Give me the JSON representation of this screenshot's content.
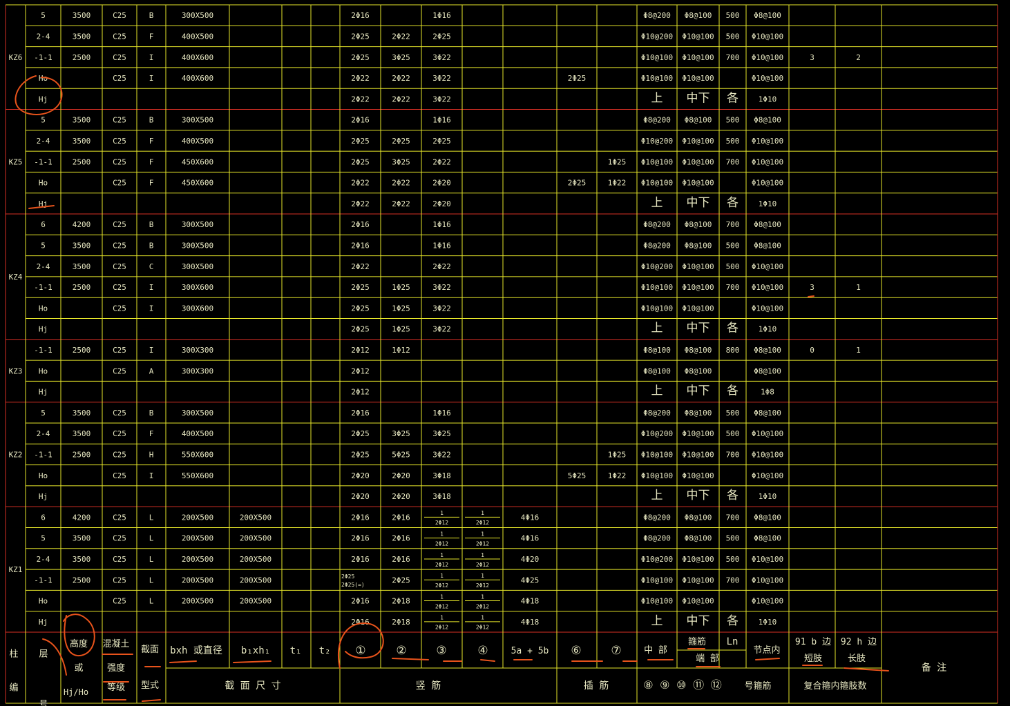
{
  "colors": {
    "background": "#000000",
    "grid": "#e6e62a",
    "group_divider": "#d93025",
    "text": "#e6e6c0",
    "annotation": "#e8531b"
  },
  "columns": [
    "group",
    "floor",
    "height",
    "grade",
    "type",
    "bxh",
    "bh1",
    "t1",
    "t2",
    "r1",
    "r2",
    "r3",
    "r4",
    "r5",
    "r6",
    "r7",
    "s_mid",
    "s_end",
    "ln",
    "s_node",
    "q1",
    "q2",
    "remark"
  ],
  "groups": [
    {
      "name": "KZ6",
      "rows": [
        {
          "floor": "5",
          "height": "3500",
          "grade": "C25",
          "type": "B",
          "bxh": "300X500",
          "r1": "2Φ16",
          "r3": "1Φ16",
          "s_mid": "Φ8@200",
          "s_end": "Φ8@100",
          "ln": "500",
          "s_node": "Φ8@100"
        },
        {
          "floor": "2-4",
          "height": "3500",
          "grade": "C25",
          "type": "F",
          "bxh": "400X500",
          "r1": "2Φ25",
          "r2": "2Φ22",
          "r3": "2Φ25",
          "s_mid": "Φ10@200",
          "s_end": "Φ10@100",
          "ln": "500",
          "s_node": "Φ10@100"
        },
        {
          "floor": "-1-1",
          "height": "2500",
          "grade": "C25",
          "type": "I",
          "bxh": "400X600",
          "r1": "2Φ25",
          "r2": "3Φ25",
          "r3": "3Φ22",
          "s_mid": "Φ10@100",
          "s_end": "Φ10@100",
          "ln": "700",
          "s_node": "Φ10@100",
          "q1": "3",
          "q2": "2"
        },
        {
          "floor": "Ho",
          "grade": "C25",
          "type": "I",
          "bxh": "400X600",
          "r1": "2Φ22",
          "r2": "2Φ22",
          "r3": "3Φ22",
          "r6": "2Φ25",
          "s_mid": "Φ10@100",
          "s_end": "Φ10@100",
          "s_node": "Φ10@100"
        },
        {
          "floor": "Hj",
          "r1": "2Φ22",
          "r2": "2Φ22",
          "r3": "3Φ22",
          "s_mid": "上",
          "s_end": "中下",
          "ln": "各",
          "s_node": "1Φ10"
        }
      ]
    },
    {
      "name": "KZ5",
      "rows": [
        {
          "floor": "5",
          "height": "3500",
          "grade": "C25",
          "type": "B",
          "bxh": "300X500",
          "r1": "2Φ16",
          "r3": "1Φ16",
          "s_mid": "Φ8@200",
          "s_end": "Φ8@100",
          "ln": "500",
          "s_node": "Φ8@100"
        },
        {
          "floor": "2-4",
          "height": "3500",
          "grade": "C25",
          "type": "F",
          "bxh": "400X500",
          "r1": "2Φ25",
          "r2": "2Φ25",
          "r3": "2Φ25",
          "s_mid": "Φ10@200",
          "s_end": "Φ10@100",
          "ln": "500",
          "s_node": "Φ10@100"
        },
        {
          "floor": "-1-1",
          "height": "2500",
          "grade": "C25",
          "type": "F",
          "bxh": "450X600",
          "r1": "2Φ25",
          "r2": "3Φ25",
          "r3": "2Φ22",
          "r7": "1Φ25",
          "s_mid": "Φ10@100",
          "s_end": "Φ10@100",
          "ln": "700",
          "s_node": "Φ10@100"
        },
        {
          "floor": "Ho",
          "grade": "C25",
          "type": "F",
          "bxh": "450X600",
          "r1": "2Φ22",
          "r2": "2Φ22",
          "r3": "2Φ20",
          "r6": "2Φ25",
          "r7": "1Φ22",
          "s_mid": "Φ10@100",
          "s_end": "Φ10@100",
          "s_node": "Φ10@100"
        },
        {
          "floor": "Hj",
          "r1": "2Φ22",
          "r2": "2Φ22",
          "r3": "2Φ20",
          "s_mid": "上",
          "s_end": "中下",
          "ln": "各",
          "s_node": "1Φ10"
        }
      ]
    },
    {
      "name": "KZ4",
      "rows": [
        {
          "floor": "6",
          "height": "4200",
          "grade": "C25",
          "type": "B",
          "bxh": "300X500",
          "r1": "2Φ16",
          "r3": "1Φ16",
          "s_mid": "Φ8@200",
          "s_end": "Φ8@100",
          "ln": "700",
          "s_node": "Φ8@100"
        },
        {
          "floor": "5",
          "height": "3500",
          "grade": "C25",
          "type": "B",
          "bxh": "300X500",
          "r1": "2Φ16",
          "r3": "1Φ16",
          "s_mid": "Φ8@200",
          "s_end": "Φ8@100",
          "ln": "500",
          "s_node": "Φ8@100"
        },
        {
          "floor": "2-4",
          "height": "3500",
          "grade": "C25",
          "type": "C",
          "bxh": "300X500",
          "r1": "2Φ22",
          "r3": "2Φ22",
          "s_mid": "Φ10@200",
          "s_end": "Φ10@100",
          "ln": "500",
          "s_node": "Φ10@100"
        },
        {
          "floor": "-1-1",
          "height": "2500",
          "grade": "C25",
          "type": "I",
          "bxh": "300X600",
          "r1": "2Φ25",
          "r2": "1Φ25",
          "r3": "3Φ22",
          "s_mid": "Φ10@100",
          "s_end": "Φ10@100",
          "ln": "700",
          "s_node": "Φ10@100",
          "q1": "3",
          "q2": "1"
        },
        {
          "floor": "Ho",
          "grade": "C25",
          "type": "I",
          "bxh": "300X600",
          "r1": "2Φ25",
          "r2": "1Φ25",
          "r3": "3Φ22",
          "s_mid": "Φ10@100",
          "s_end": "Φ10@100",
          "s_node": "Φ10@100"
        },
        {
          "floor": "Hj",
          "r1": "2Φ25",
          "r2": "1Φ25",
          "r3": "3Φ22",
          "s_mid": "上",
          "s_end": "中下",
          "ln": "各",
          "s_node": "1Φ10"
        }
      ]
    },
    {
      "name": "KZ3",
      "rows": [
        {
          "floor": "-1-1",
          "height": "2500",
          "grade": "C25",
          "type": "I",
          "bxh": "300X300",
          "r1": "2Φ12",
          "r2": "1Φ12",
          "s_mid": "Φ8@100",
          "s_end": "Φ8@100",
          "ln": "800",
          "s_node": "Φ8@100",
          "q1": "0",
          "q2": "1"
        },
        {
          "floor": "Ho",
          "grade": "C25",
          "type": "A",
          "bxh": "300X300",
          "r1": "2Φ12",
          "s_mid": "Φ8@100",
          "s_end": "Φ8@100",
          "s_node": "Φ8@100"
        },
        {
          "floor": "Hj",
          "r1": "2Φ12",
          "s_mid": "上",
          "s_end": "中下",
          "ln": "各",
          "s_node": "1Φ8"
        }
      ]
    },
    {
      "name": "KZ2",
      "rows": [
        {
          "floor": "5",
          "height": "3500",
          "grade": "C25",
          "type": "B",
          "bxh": "300X500",
          "r1": "2Φ16",
          "r3": "1Φ16",
          "s_mid": "Φ8@200",
          "s_end": "Φ8@100",
          "ln": "500",
          "s_node": "Φ8@100"
        },
        {
          "floor": "2-4",
          "height": "3500",
          "grade": "C25",
          "type": "F",
          "bxh": "400X500",
          "r1": "2Φ25",
          "r2": "3Φ25",
          "r3": "3Φ25",
          "s_mid": "Φ10@200",
          "s_end": "Φ10@100",
          "ln": "500",
          "s_node": "Φ10@100"
        },
        {
          "floor": "-1-1",
          "height": "2500",
          "grade": "C25",
          "type": "H",
          "bxh": "550X600",
          "r1": "2Φ25",
          "r2": "5Φ25",
          "r3": "3Φ22",
          "r7": "1Φ25",
          "s_mid": "Φ10@100",
          "s_end": "Φ10@100",
          "ln": "700",
          "s_node": "Φ10@100"
        },
        {
          "floor": "Ho",
          "grade": "C25",
          "type": "I",
          "bxh": "550X600",
          "r1": "2Φ20",
          "r2": "2Φ20",
          "r3": "3Φ18",
          "r6": "5Φ25",
          "r7": "1Φ22",
          "s_mid": "Φ10@100",
          "s_end": "Φ10@100",
          "s_node": "Φ10@100"
        },
        {
          "floor": "Hj",
          "r1": "2Φ20",
          "r2": "2Φ20",
          "r3": "3Φ18",
          "s_mid": "上",
          "s_end": "中下",
          "ln": "各",
          "s_node": "1Φ10"
        }
      ]
    },
    {
      "name": "KZ1",
      "rows": [
        {
          "floor": "6",
          "height": "4200",
          "grade": "C25",
          "type": "L",
          "bxh": "200X500",
          "bh1": "200X500",
          "r1": "2Φ16",
          "r2": "2Φ16",
          "r3": "1|2Φ12",
          "r4": "1|2Φ12",
          "r5": "4Φ16",
          "s_mid": "Φ8@200",
          "s_end": "Φ8@100",
          "ln": "700",
          "s_node": "Φ8@100"
        },
        {
          "floor": "5",
          "height": "3500",
          "grade": "C25",
          "type": "L",
          "bxh": "200X500",
          "bh1": "200X500",
          "r1": "2Φ16",
          "r2": "2Φ16",
          "r3": "1|2Φ12",
          "r4": "1|2Φ12",
          "r5": "4Φ16",
          "s_mid": "Φ8@200",
          "s_end": "Φ8@100",
          "ln": "500",
          "s_node": "Φ8@100"
        },
        {
          "floor": "2-4",
          "height": "3500",
          "grade": "C25",
          "type": "L",
          "bxh": "200X500",
          "bh1": "200X500",
          "r1": "2Φ16",
          "r2": "2Φ16",
          "r3": "1|2Φ12",
          "r4": "1|2Φ12",
          "r5": "4Φ20",
          "s_mid": "Φ10@200",
          "s_end": "Φ10@100",
          "ln": "500",
          "s_node": "Φ10@100"
        },
        {
          "floor": "-1-1",
          "height": "2500",
          "grade": "C25",
          "type": "L",
          "bxh": "200X500",
          "bh1": "200X500",
          "r1": "2Φ25|2Φ25(=)",
          "r2": "2Φ25",
          "r3": "1|2Φ12",
          "r4": "1|2Φ12",
          "r5": "4Φ25",
          "s_mid": "Φ10@100",
          "s_end": "Φ10@100",
          "ln": "700",
          "s_node": "Φ10@100"
        },
        {
          "floor": "Ho",
          "grade": "C25",
          "type": "L",
          "bxh": "200X500",
          "bh1": "200X500",
          "r1": "2Φ16",
          "r2": "2Φ18",
          "r3": "1|2Φ12",
          "r4": "1|2Φ12",
          "r5": "4Φ18",
          "s_mid": "Φ10@100",
          "s_end": "Φ10@100",
          "s_node": "Φ10@100"
        },
        {
          "floor": "Hj",
          "r1": "2Φ16",
          "r2": "2Φ18",
          "r3": "1|2Φ12",
          "r4": "1|2Φ12",
          "r5": "4Φ18",
          "s_mid": "上",
          "s_end": "中下",
          "ln": "各",
          "s_node": "1Φ10"
        }
      ]
    }
  ],
  "header": {
    "col_number": "柱 编 号",
    "floor": "层 号",
    "height_top": "高度",
    "height_mid": "或",
    "height_bottom": "Hj/Ho",
    "grade_top": "混凝土",
    "grade_mid": "强度",
    "grade_bottom": "等级",
    "type_top": "截面",
    "type_bottom": "型式",
    "bxh": "bxh  或直径",
    "bh1": "b₁xh₁",
    "t1": "t₁",
    "t2": "t₂",
    "size_group": "截 面 尺 寸",
    "r1": "①",
    "r2": "②",
    "r3": "③",
    "r4": "④",
    "r5": "5a  +  5b",
    "rebar_group": "竖        筋",
    "r6": "⑥",
    "r7": "⑦",
    "dowel_group": "插    筋",
    "s_mid": "中 部",
    "s_end_top": "箍筋",
    "s_end": "端  部",
    "ln": "Ln",
    "s_node": "节点内",
    "stirrup_nums": "⑧ ⑨ ⑩ ⑪ ⑫",
    "stirrup_group": "号箍筋",
    "q1_top": "91  b 边",
    "q1_bottom": "短肢",
    "q2_top": "92  h 边",
    "q2_bottom": "长肢",
    "composite_group": "复合箍内箍肢数",
    "remark": "备  注"
  }
}
